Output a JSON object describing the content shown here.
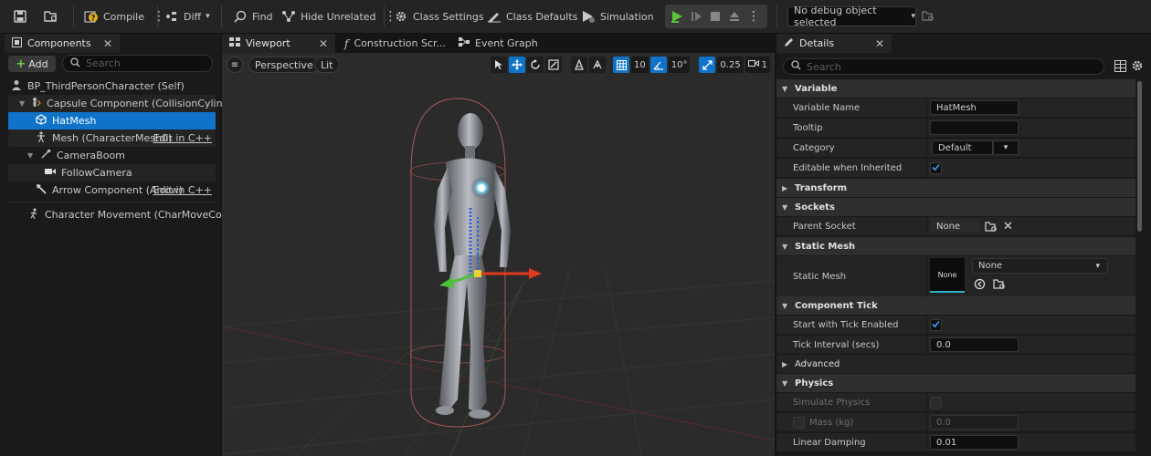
{
  "toolbar": {
    "compile": "Compile",
    "diff": "Diff",
    "find": "Find",
    "hide_unrelated": "Hide Unrelated",
    "class_settings": "Class Settings",
    "class_defaults": "Class Defaults",
    "simulation": "Simulation",
    "debug_object": "No debug object selected"
  },
  "components": {
    "tab_title": "Components",
    "add_label": "Add",
    "search_placeholder": "Search",
    "edit_label": "Edit in C++",
    "items": [
      "BP_ThirdPersonCharacter (Self)",
      "Capsule Component (CollisionCylinder)",
      "HatMesh",
      "Mesh (CharacterMesh0)",
      "CameraBoom",
      "FollowCamera",
      "Arrow Component (Arrow)",
      "Character Movement (CharMoveComp)"
    ]
  },
  "viewport": {
    "tabs": [
      "Viewport",
      "Construction Scr...",
      "Event Graph"
    ],
    "perspective": "Perspective",
    "lit": "Lit",
    "grid_size": "10",
    "rotation_snap": "10°",
    "scale_snap": "0.25",
    "camera_speed": "1"
  },
  "details": {
    "tab_title": "Details",
    "search_placeholder": "Search",
    "categories": {
      "variable": "Variable",
      "transform": "Transform",
      "sockets": "Sockets",
      "static_mesh": "Static Mesh",
      "component_tick": "Component Tick",
      "advanced": "Advanced",
      "physics": "Physics"
    },
    "props": {
      "variable_name": "Variable Name",
      "variable_name_value": "HatMesh",
      "tooltip": "Tooltip",
      "category": "Category",
      "category_value": "Default",
      "editable_inherited": "Editable when Inherited",
      "parent_socket": "Parent Socket",
      "parent_socket_value": "None",
      "static_mesh": "Static Mesh",
      "static_mesh_thumb": "None",
      "static_mesh_value": "None",
      "start_tick": "Start with Tick Enabled",
      "tick_interval": "Tick Interval (secs)",
      "tick_interval_value": "0.0",
      "simulate_physics": "Simulate Physics",
      "mass": "Mass (kg)",
      "mass_value": "0.0",
      "linear_damping": "Linear Damping",
      "linear_damping_value": "0.01"
    }
  },
  "colors": {
    "accent": "#0f73c9",
    "play_green": "#5bc236",
    "panel_bg": "#1a1a1a",
    "viewport_bg": "#2b2b2b"
  }
}
